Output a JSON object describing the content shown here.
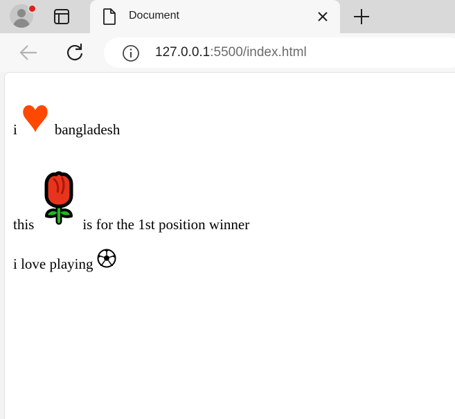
{
  "browser": {
    "tab_title": "Document",
    "url_host": "127.0.0.1",
    "url_rest": ":5500/index.html",
    "profile_badge_color": "#e0201a"
  },
  "page": {
    "line1": {
      "before": "i",
      "emoji": "heart-icon",
      "after": "bangladesh"
    },
    "line2": {
      "before": "this",
      "emoji": "rose-icon",
      "after": "is for the 1st position winner"
    },
    "line3": {
      "before": "i love playing",
      "emoji": "soccer-ball-icon"
    }
  },
  "colors": {
    "heart": "#ff4800",
    "rose_petal": "#e8341c",
    "rose_leaf": "#1fb81f"
  }
}
